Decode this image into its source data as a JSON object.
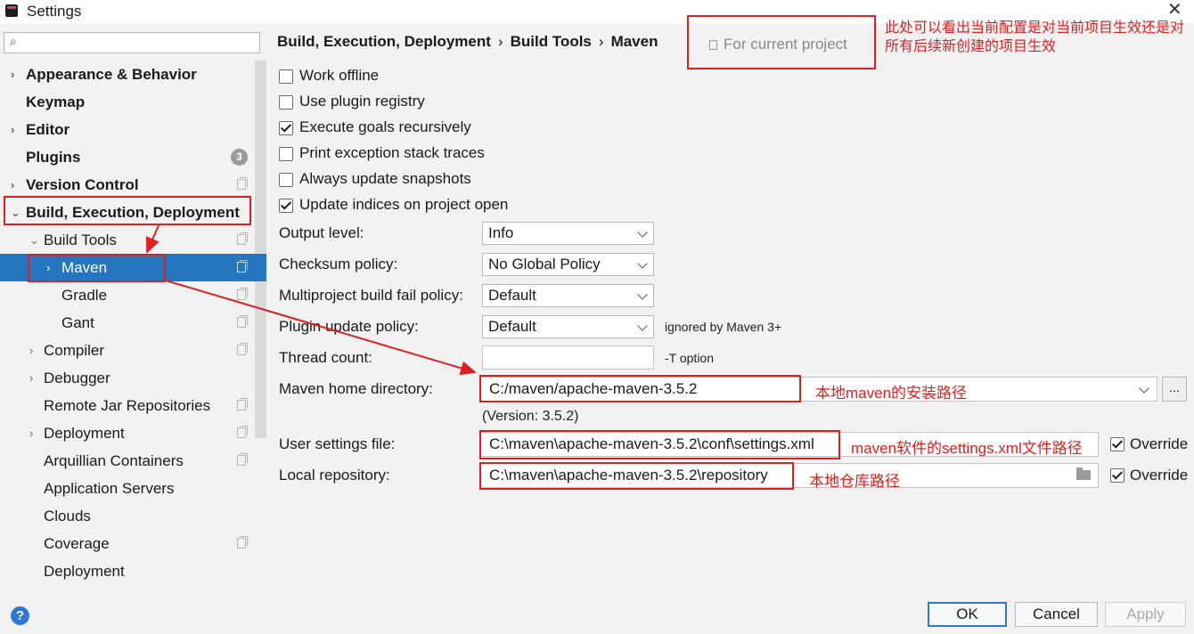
{
  "window": {
    "title": "Settings",
    "close": "✕"
  },
  "sidebar": {
    "search_value": "",
    "items": [
      {
        "label": "Appearance & Behavior",
        "arrow": "›"
      },
      {
        "label": "Keymap"
      },
      {
        "label": "Editor",
        "arrow": "›"
      },
      {
        "label": "Plugins",
        "badge": "3"
      },
      {
        "label": "Version Control",
        "arrow": "›"
      },
      {
        "label": "Build, Execution, Deployment",
        "arrow": "⌄"
      },
      {
        "label": "Build Tools",
        "arrow": "⌄"
      },
      {
        "label": "Maven",
        "arrow": "›",
        "selected": true
      },
      {
        "label": "Gradle"
      },
      {
        "label": "Gant"
      },
      {
        "label": "Compiler",
        "arrow": "›"
      },
      {
        "label": "Debugger",
        "arrow": "›"
      },
      {
        "label": "Remote Jar Repositories"
      },
      {
        "label": "Deployment",
        "arrow": "›"
      },
      {
        "label": "Arquillian Containers"
      },
      {
        "label": "Application Servers"
      },
      {
        "label": "Clouds"
      },
      {
        "label": "Coverage"
      },
      {
        "label": "Deployment"
      }
    ]
  },
  "breadcrumb": {
    "part1": "Build, Execution, Deployment",
    "part2": "Build Tools",
    "part3": "Maven",
    "sep": "›"
  },
  "scope": {
    "label": "For current project"
  },
  "annotations": {
    "scope_note": "此处可以看出当前配置是对当前项目生效还是对所有后续新创建的项目生效",
    "home_note": "本地maven的安装路径",
    "settings_note": "maven软件的settings.xml文件路径",
    "repo_note": "本地仓库路径"
  },
  "checkboxes": {
    "work_offline": {
      "label": "Work offline",
      "checked": false
    },
    "plugin_registry": {
      "label": "Use plugin registry",
      "checked": false
    },
    "recursive": {
      "label": "Execute goals recursively",
      "checked": true
    },
    "stack_traces": {
      "label": "Print exception stack traces",
      "checked": false
    },
    "snapshots": {
      "label": "Always update snapshots",
      "checked": false
    },
    "indices": {
      "label": "Update indices on project open",
      "checked": true
    }
  },
  "fields": {
    "output_level": {
      "label": "Output level:",
      "value": "Info"
    },
    "checksum": {
      "label": "Checksum policy:",
      "value": "No Global Policy"
    },
    "fail_policy": {
      "label": "Multiproject build fail policy:",
      "value": "Default"
    },
    "plugin_update": {
      "label": "Plugin update policy:",
      "value": "Default",
      "hint": "ignored by Maven 3+"
    },
    "thread_count": {
      "label": "Thread count:",
      "value": "",
      "hint": "-T option"
    },
    "maven_home": {
      "label": "Maven home directory:",
      "value": "C:/maven/apache-maven-3.5.2",
      "browse": "...",
      "version": "(Version: 3.5.2)"
    },
    "user_settings": {
      "label": "User settings file:",
      "value": "C:\\maven\\apache-maven-3.5.2\\conf\\settings.xml",
      "override": "Override",
      "override_checked": true
    },
    "local_repo": {
      "label": "Local repository:",
      "value": "C:\\maven\\apache-maven-3.5.2\\repository",
      "override": "Override",
      "override_checked": true
    }
  },
  "buttons": {
    "help": "?",
    "ok": "OK",
    "cancel": "Cancel",
    "apply": "Apply"
  },
  "colors": {
    "accent": "#2675bf",
    "annotation": "#e02020"
  }
}
